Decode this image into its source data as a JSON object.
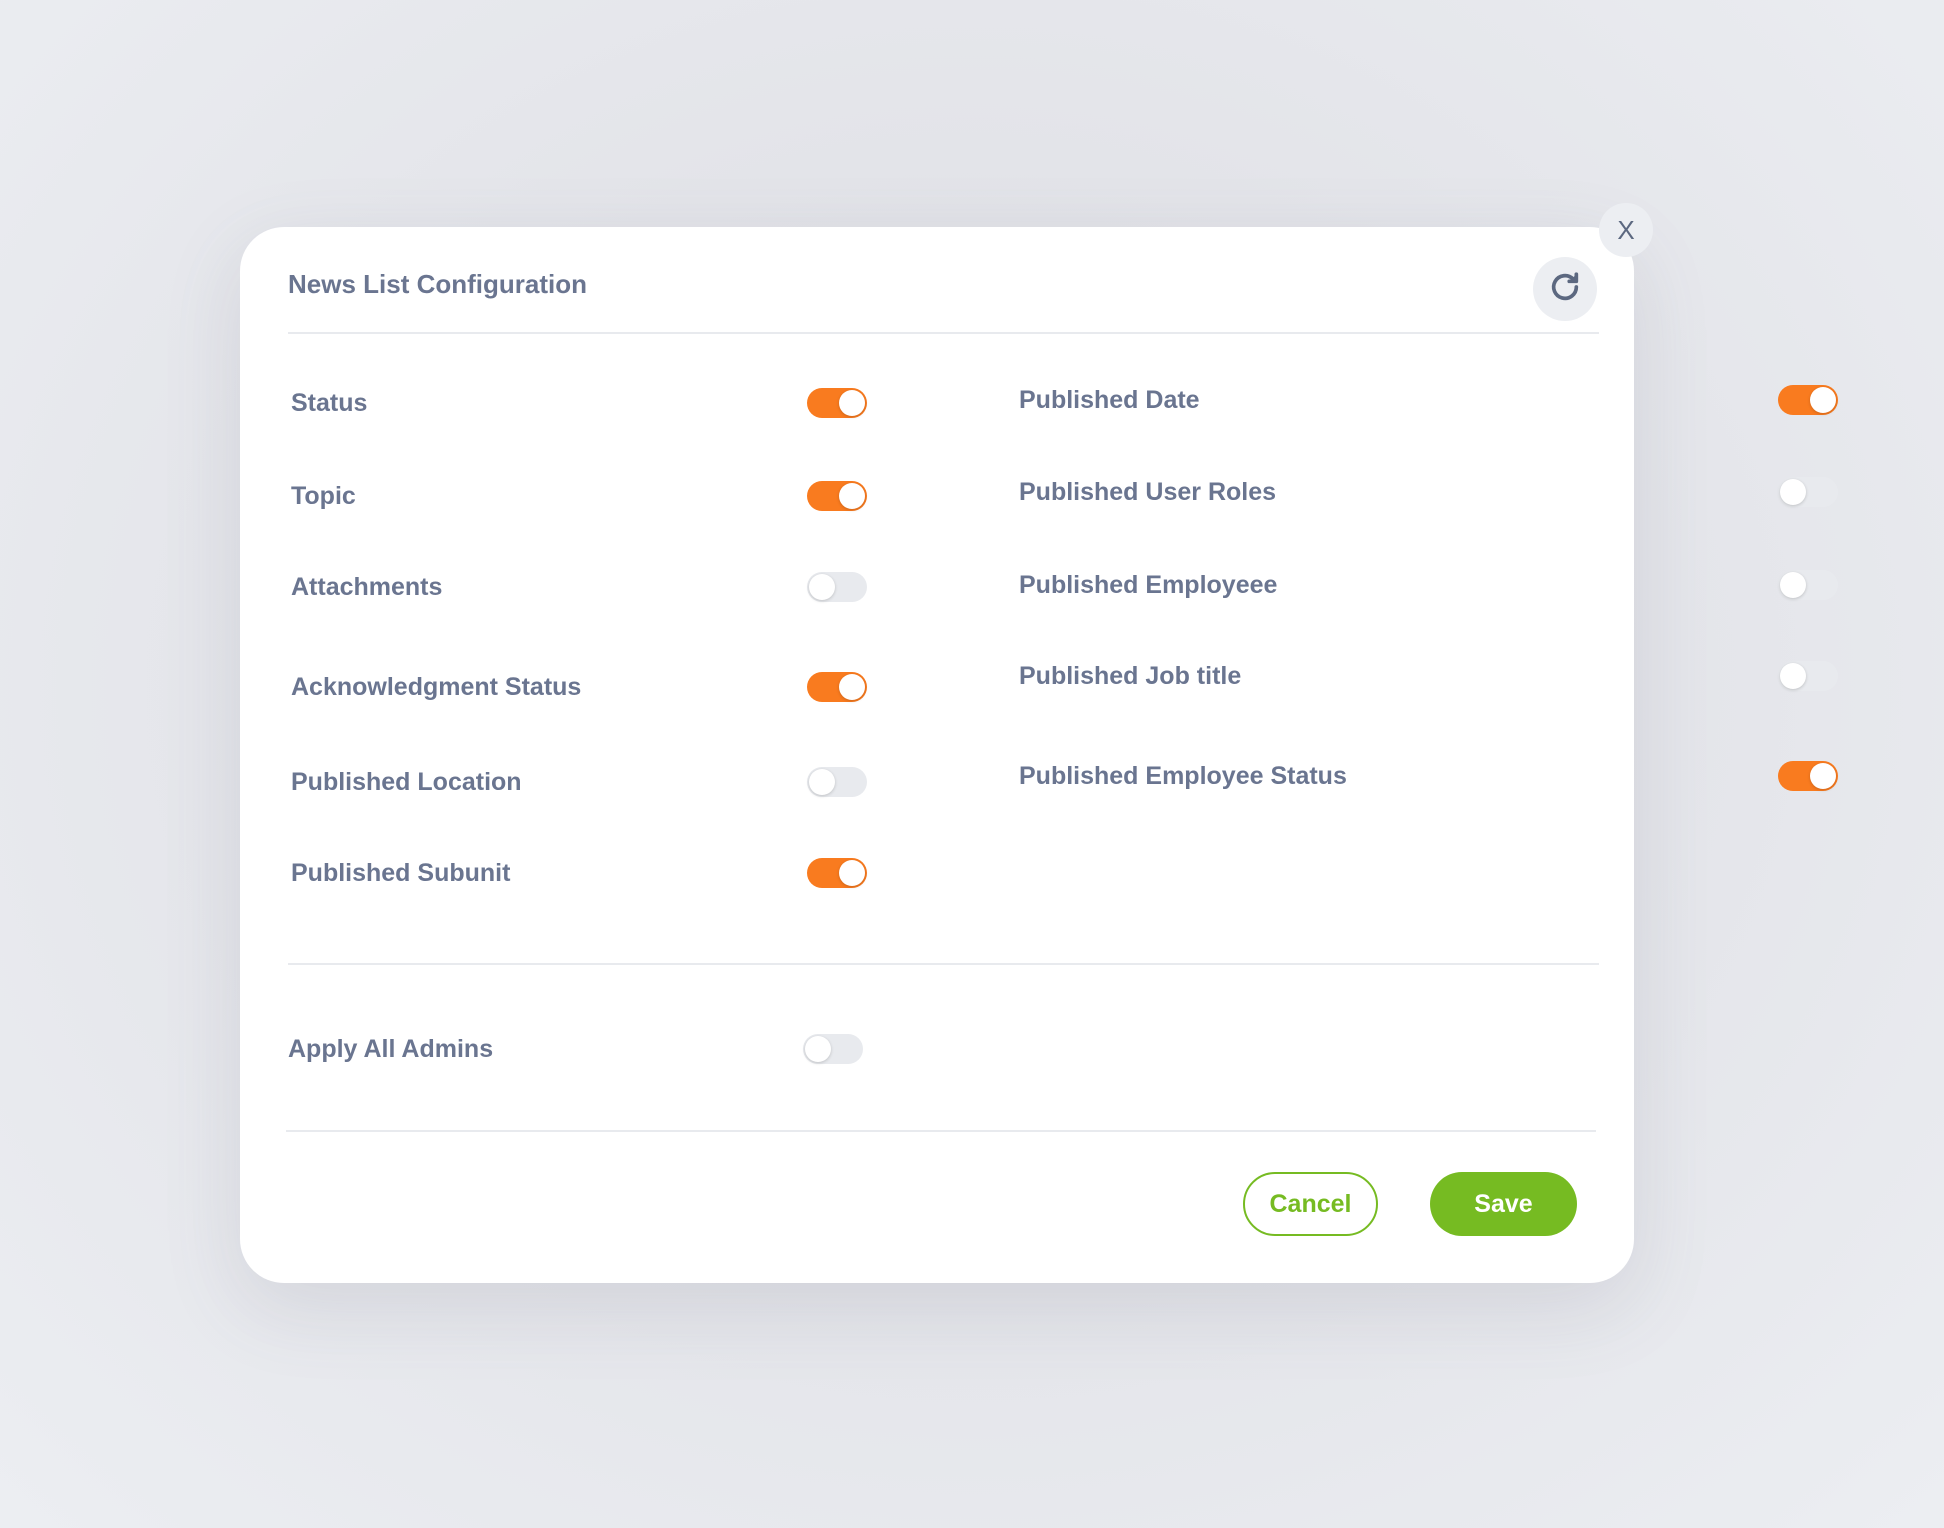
{
  "modal": {
    "title": "News List Configuration",
    "close_label": "X",
    "refresh_icon": "refresh-icon"
  },
  "settings_left": [
    {
      "label": "Status",
      "enabled": true
    },
    {
      "label": "Topic",
      "enabled": true
    },
    {
      "label": "Attachments",
      "enabled": false
    },
    {
      "label": "Acknowledgment Status",
      "enabled": true
    },
    {
      "label": "Published Location",
      "enabled": false
    },
    {
      "label": "Published Subunit",
      "enabled": true
    }
  ],
  "settings_right": [
    {
      "label": "Published Date",
      "enabled": true
    },
    {
      "label": "Published User Roles",
      "enabled": false
    },
    {
      "label": "Published Employeee",
      "enabled": false
    },
    {
      "label": "Published Job title",
      "enabled": false
    },
    {
      "label": "Published Employee Status",
      "enabled": true
    }
  ],
  "apply_all": {
    "label": "Apply All Admins",
    "enabled": false
  },
  "footer": {
    "cancel_label": "Cancel",
    "save_label": "Save"
  },
  "colors": {
    "toggle_on": "#f97b1f",
    "toggle_off": "#e8eaee",
    "accent_green": "#76bb22",
    "label_text": "#6a7590"
  }
}
